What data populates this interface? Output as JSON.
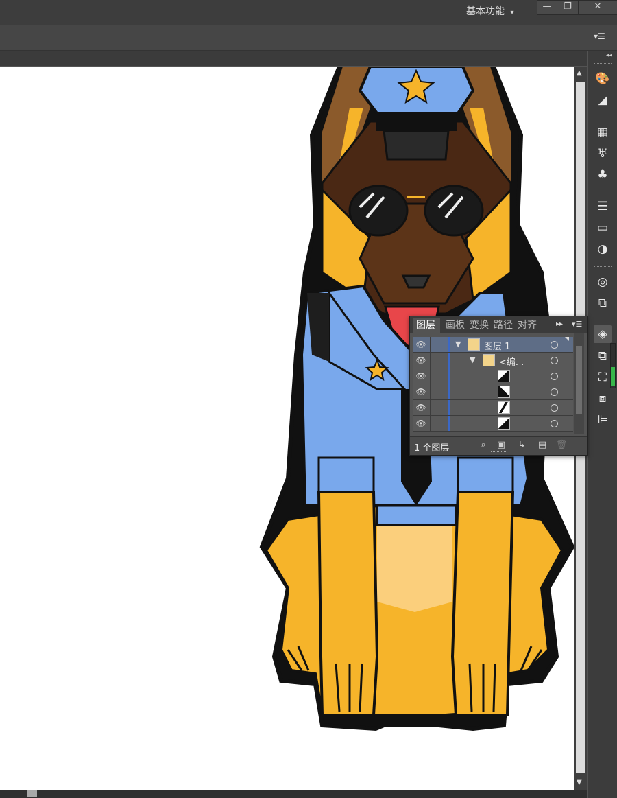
{
  "app": {
    "workspace_label": "基本功能",
    "workspace_caret": "▾",
    "window_buttons": {
      "minimize": "—",
      "restore": "❐",
      "close": "✕"
    },
    "control_menu_icon": "▾☰"
  },
  "right_panel": {
    "collapse_icon": "◂◂",
    "tools": [
      {
        "name": "color-guide-icon",
        "glyph": "🎨"
      },
      {
        "name": "gradient-swatch-icon",
        "glyph": "◢"
      },
      {
        "name": "swatches-icon",
        "glyph": "▦"
      },
      {
        "name": "brushes-icon",
        "glyph": "♅"
      },
      {
        "name": "symbols-icon",
        "glyph": "♣"
      },
      {
        "name": "stroke-icon",
        "glyph": "☰"
      },
      {
        "name": "gradient-icon",
        "glyph": "▭"
      },
      {
        "name": "transparency-icon",
        "glyph": "◑"
      },
      {
        "name": "appearance-icon",
        "glyph": "◎"
      },
      {
        "name": "graphic-styles-icon",
        "glyph": "⧉"
      },
      {
        "name": "layers-icon",
        "glyph": "◈"
      },
      {
        "name": "artboards-icon",
        "glyph": "⧉"
      },
      {
        "name": "transform-icon",
        "glyph": "⛶"
      },
      {
        "name": "pathfinder-icon",
        "glyph": "⧈"
      },
      {
        "name": "align-icon",
        "glyph": "⊫"
      }
    ]
  },
  "layers_panel": {
    "tabs": [
      "图层",
      "画板",
      "变换",
      "路径",
      "对齐"
    ],
    "active_tab": "图层",
    "expand_icon": "▸▸",
    "menu_icon": "▾☰",
    "rows": [
      {
        "indent": 0,
        "toggle": "▼",
        "name": "图层 1",
        "thumb": "dog"
      },
      {
        "indent": 1,
        "toggle": "▼",
        "name": "<编. .",
        "thumb": "dog"
      },
      {
        "indent": 2,
        "toggle": "",
        "name": "",
        "thumb": "shape-a"
      },
      {
        "indent": 2,
        "toggle": "",
        "name": "",
        "thumb": "shape-b"
      },
      {
        "indent": 2,
        "toggle": "",
        "name": "",
        "thumb": "shape-c"
      },
      {
        "indent": 2,
        "toggle": "",
        "name": "",
        "thumb": "shape-d"
      }
    ],
    "footer_count": "1 个图层",
    "footer_icons": [
      "locate-object-icon",
      "make-clipping-mask-icon",
      "create-sublayer-icon",
      "new-layer-icon",
      "delete-layer-icon"
    ]
  },
  "colors": {
    "uniform_blue": "#79a8ec",
    "dog_brown": "#8b5a2b",
    "dog_dark": "#3b1f10",
    "dog_tan": "#f6b42a",
    "belly": "#fbcf7c",
    "outline": "#111111"
  }
}
